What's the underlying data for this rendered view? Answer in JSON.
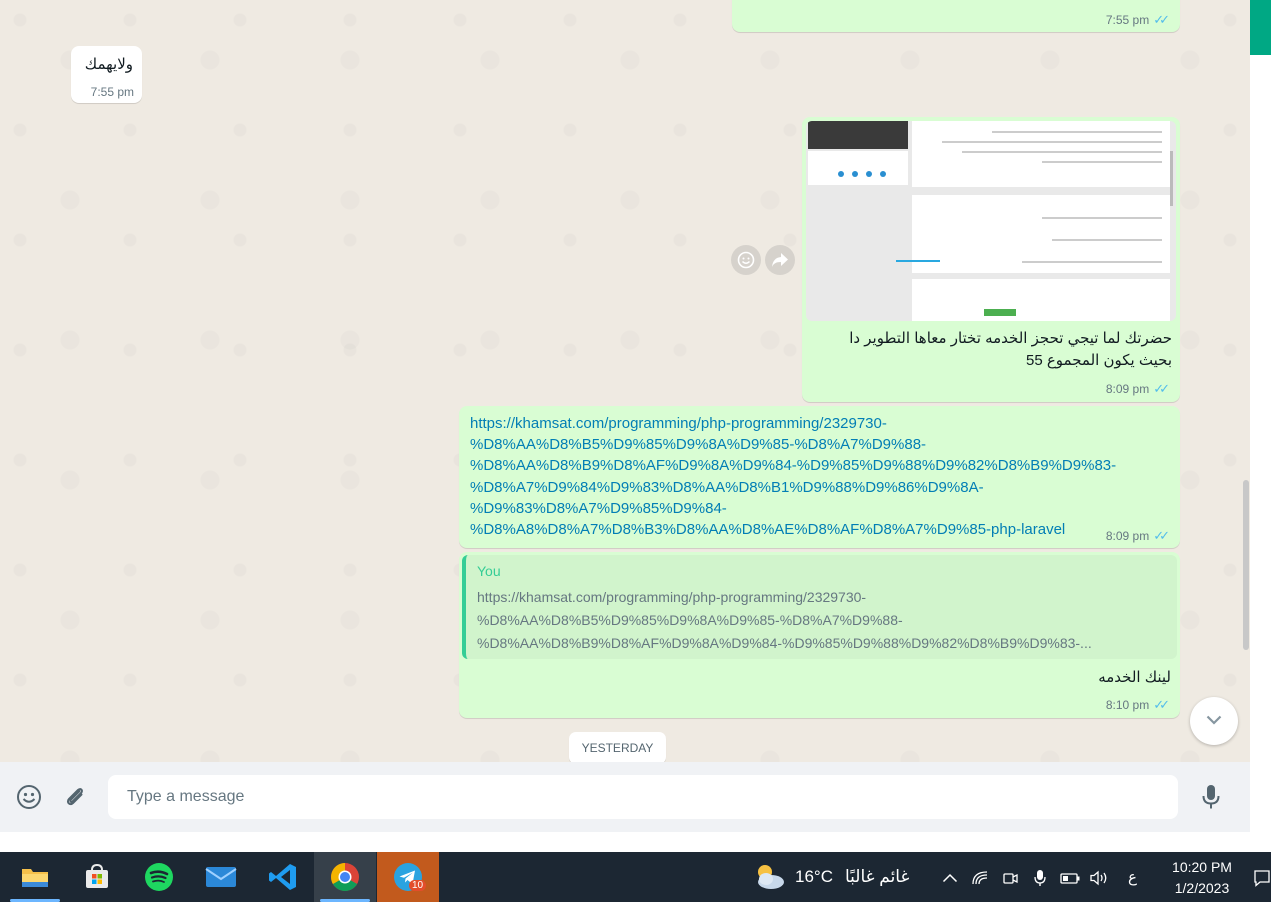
{
  "chat": {
    "messages": [
      {
        "time": "7:55 pm"
      },
      {
        "text": "ولايهمك",
        "time": "7:55 pm"
      },
      {
        "caption_line1": "حضرتك لما تيجي تحجز الخدمه تختار معاها التطوير دا",
        "caption_line2": "بحيث يكون المجموع 55",
        "time": "8:09 pm"
      },
      {
        "link_lines": [
          "https://khamsat.com/programming/php-programming/2329730-",
          "%D8%AA%D8%B5%D9%85%D9%8A%D9%85-%D8%A7%D9%88-",
          "%D8%AA%D8%B9%D8%AF%D9%8A%D9%84-%D9%85%D9%88%D9%82%D8%B9%D9%83-",
          "%D8%A7%D9%84%D9%83%D8%AA%D8%B1%D9%88%D9%86%D9%8A-",
          "%D9%83%D8%A7%D9%85%D9%84-",
          "%D8%A8%D8%A7%D8%B3%D8%AA%D8%AE%D8%AF%D8%A7%D9%85-php-laravel"
        ],
        "time": "8:09 pm"
      },
      {
        "quote_author": "You",
        "quote_lines": [
          "https://khamsat.com/programming/php-programming/2329730-",
          "%D8%AA%D8%B5%D9%85%D9%8A%D9%85-%D8%A7%D9%88-",
          "%D8%AA%D8%B9%D8%AF%D9%8A%D9%84-%D9%85%D9%88%D9%82%D8%B9%D9%83-..."
        ],
        "text": "لينك الخدمه",
        "time": "8:10 pm"
      }
    ],
    "day_separator": "YESTERDAY"
  },
  "composer": {
    "placeholder": "Type a message"
  },
  "taskbar": {
    "telegram_badge": "10",
    "weather_temp": "16°C",
    "weather_text": "غائم غالبًا",
    "language": "ع",
    "time": "10:20 PM",
    "date": "1/2/2023"
  },
  "colors": {
    "outgoing": "#d9fdd3",
    "incoming": "#ffffff",
    "link": "#027eb5",
    "ticks": "#53bdeb",
    "accent": "#00a884"
  },
  "icons": [
    "emoji-icon",
    "attach-icon",
    "mic-icon",
    "chevron-down-icon",
    "forward-icon",
    "reaction-icon",
    "double-check-icon"
  ]
}
